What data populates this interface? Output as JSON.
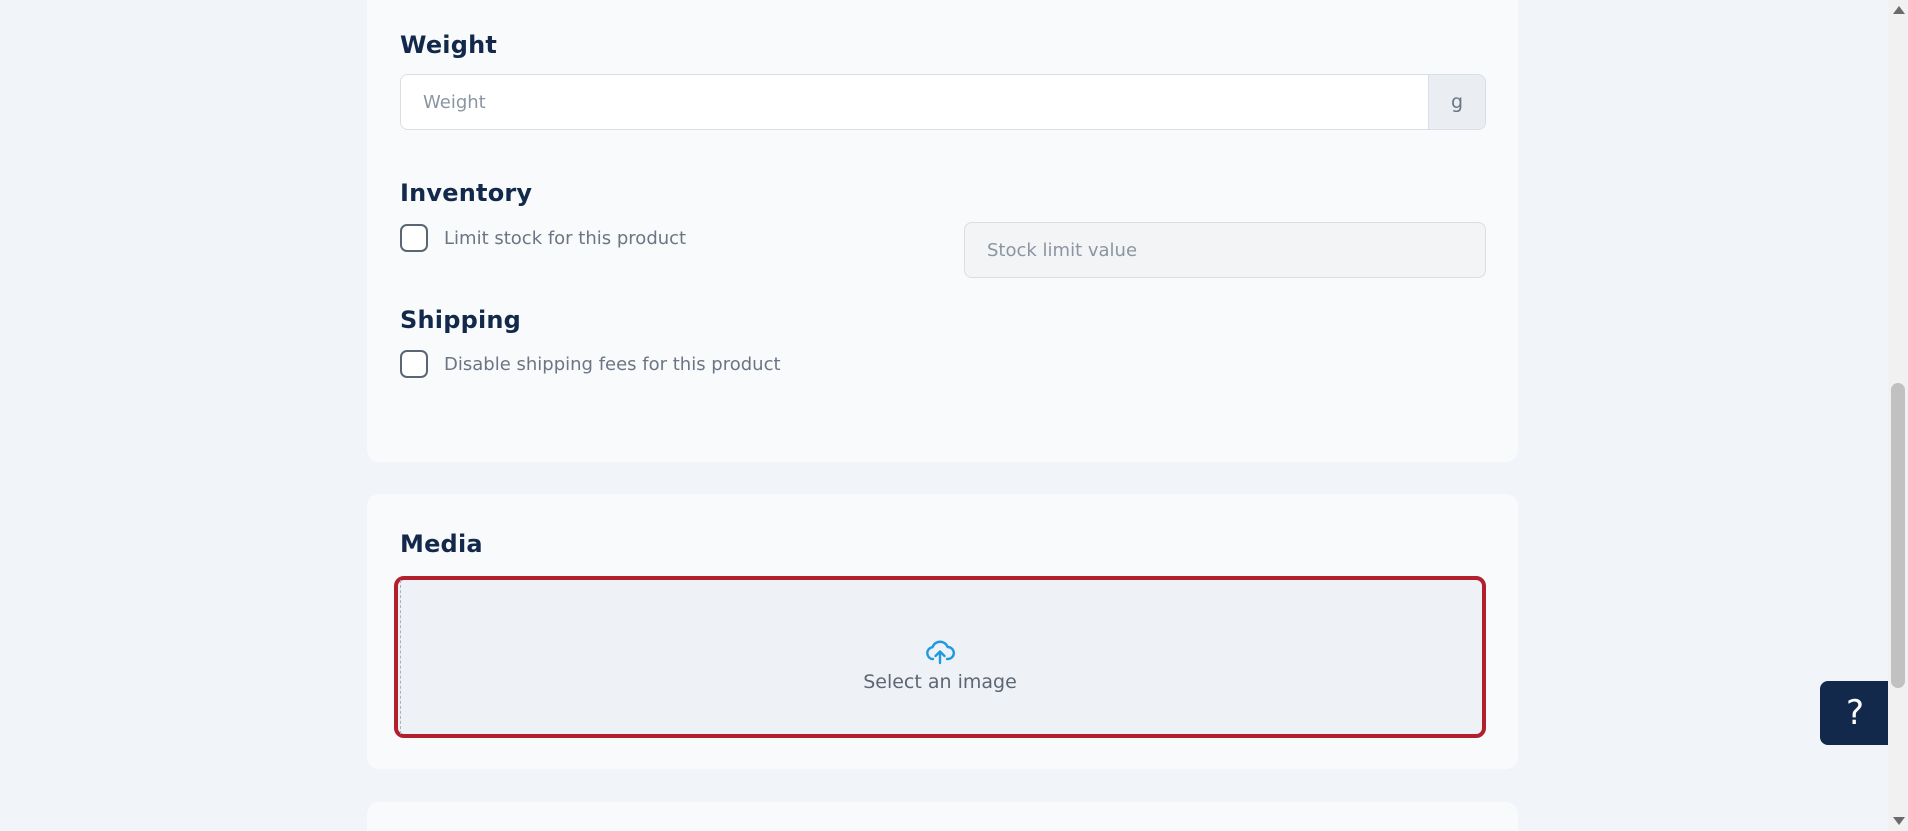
{
  "weight": {
    "title": "Weight",
    "placeholder": "Weight",
    "value": "",
    "unit": "g"
  },
  "inventory": {
    "title": "Inventory",
    "limit_label": "Limit stock for this product",
    "limit_checked": false,
    "stock_placeholder": "Stock limit value"
  },
  "shipping": {
    "title": "Shipping",
    "disable_label": "Disable shipping fees for this product",
    "disable_checked": false
  },
  "media": {
    "title": "Media",
    "upload_label": "Select an image",
    "upload_icon": "cloud-upload-icon",
    "error_border_color": "#b21f2d",
    "icon_color": "#1e9be0"
  },
  "help": {
    "label": "?",
    "background": "#13294b"
  }
}
